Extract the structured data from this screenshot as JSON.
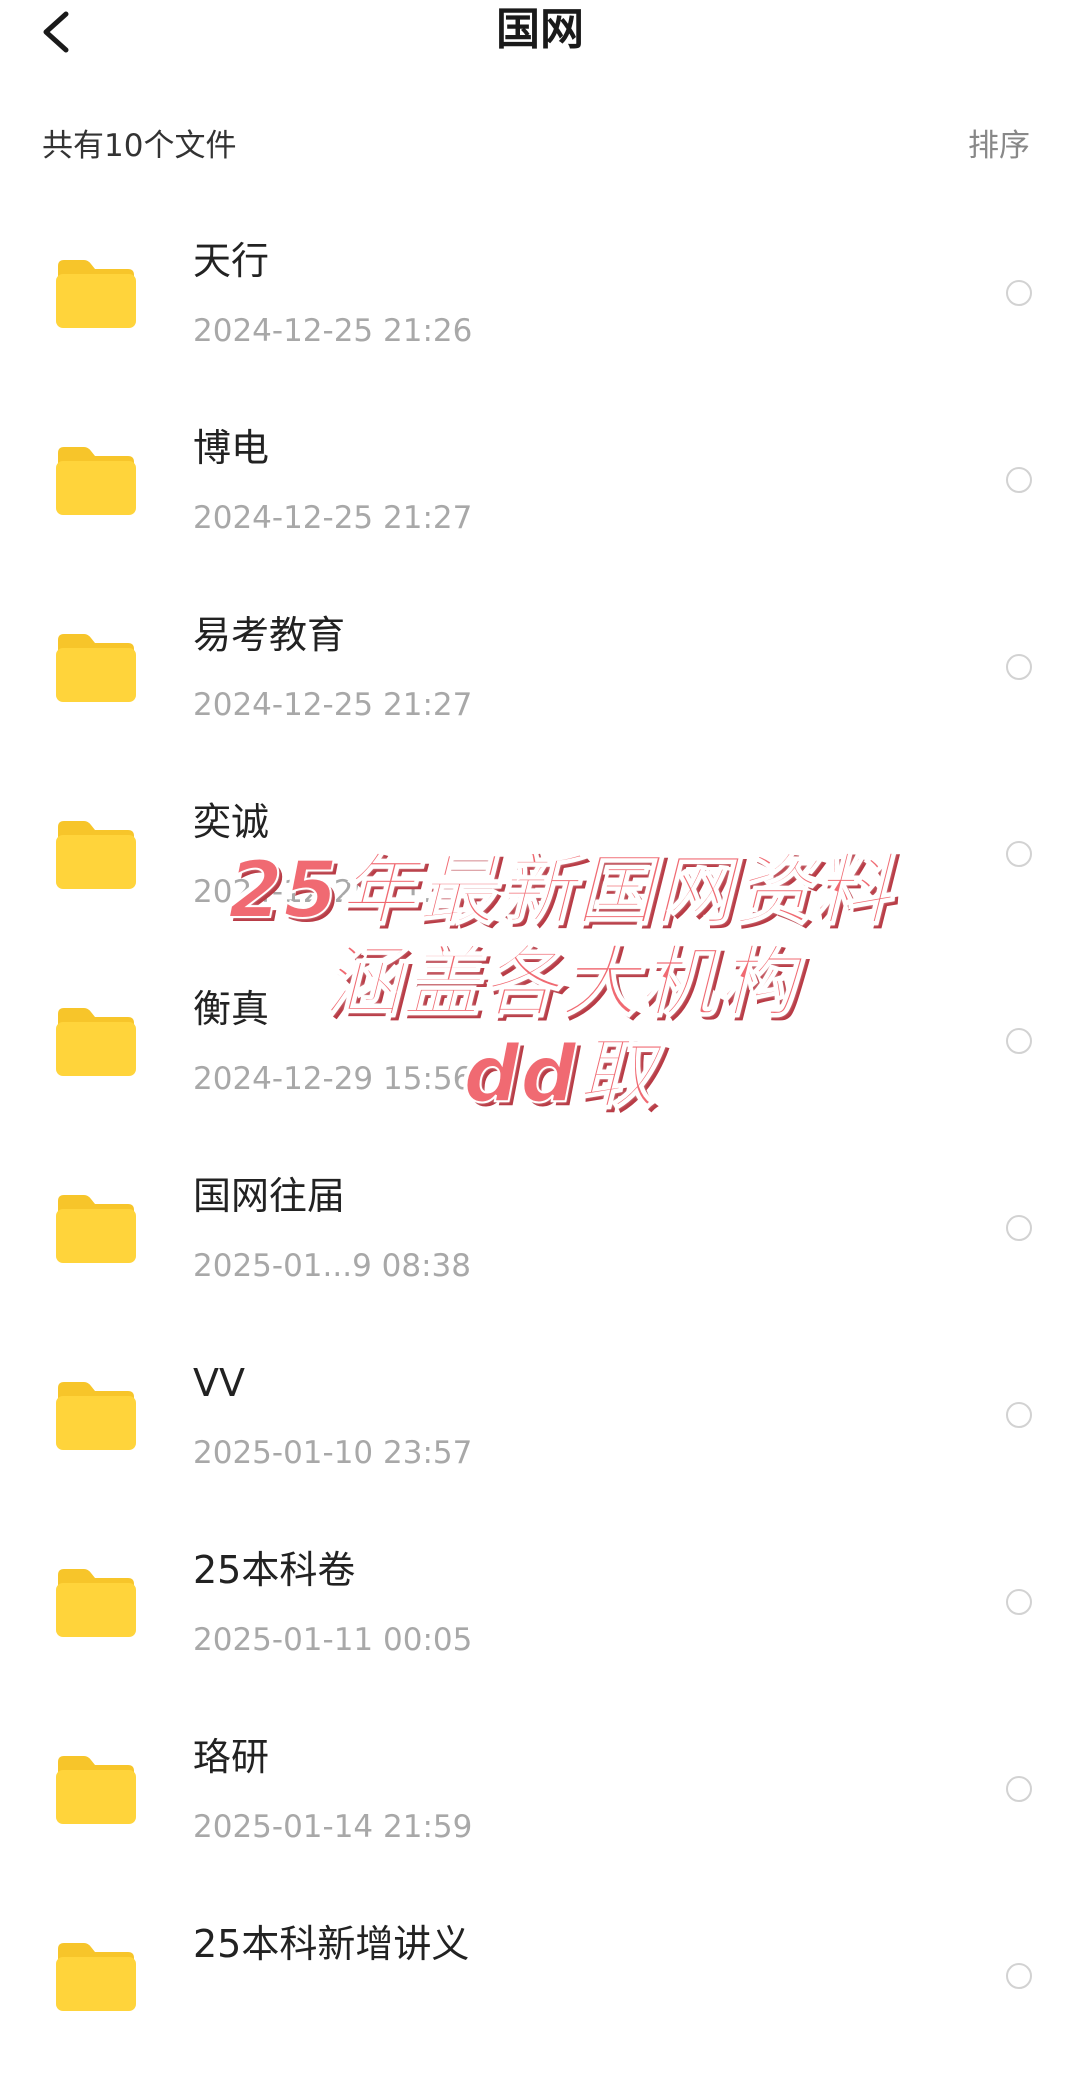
{
  "header": {
    "title": "国网",
    "back_icon": "chevron-left-icon"
  },
  "subbar": {
    "file_count": "共有10个文件",
    "sort_label": "排序"
  },
  "colors": {
    "folder": "#ffd43b",
    "folder_tab": "#f7c52a",
    "watermark": "#f06a72",
    "date_text": "#a8a8a8"
  },
  "files": [
    {
      "name": "天行",
      "date": "2024-12-25 21:26"
    },
    {
      "name": "博电",
      "date": "2024-12-25 21:27"
    },
    {
      "name": "易考教育",
      "date": "2024-12-25 21:27"
    },
    {
      "name": "奕诚",
      "date": "2024-12-25 21:28"
    },
    {
      "name": "衡真",
      "date": "2024-12-29 15:56"
    },
    {
      "name": "国网往届",
      "date": "2025-01...9 08:38"
    },
    {
      "name": "VV",
      "date": "2025-01-10 23:57"
    },
    {
      "name": "25本科卷",
      "date": "2025-01-11 00:05"
    },
    {
      "name": "珞研",
      "date": "2025-01-14 21:59"
    },
    {
      "name": "25本科新增讲义",
      "date": ""
    }
  ],
  "watermark": {
    "line1": "25年最新国网资料",
    "line2": "涵盖各大机构",
    "line3": "dd取"
  }
}
